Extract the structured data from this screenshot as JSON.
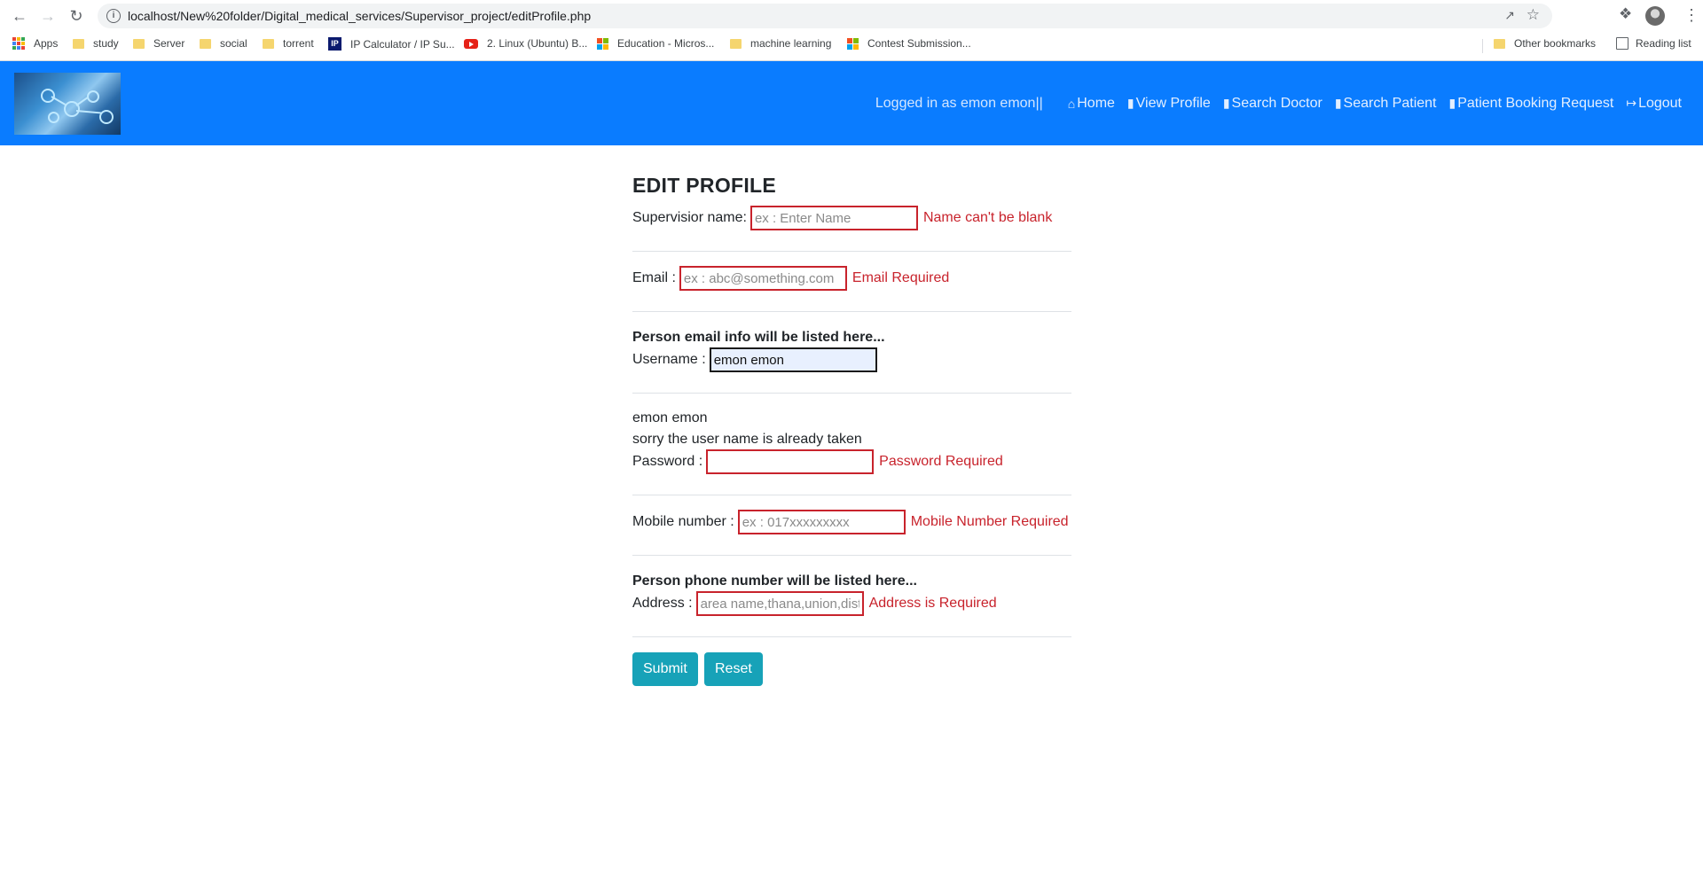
{
  "browser": {
    "url": "localhost/New%20folder/Digital_medical_services/Supervisor_project/editProfile.php",
    "bookmarks": [
      {
        "label": "Apps",
        "icon": "apps-grid-icon"
      },
      {
        "label": "study",
        "icon": "folder-icon"
      },
      {
        "label": "Server",
        "icon": "folder-icon"
      },
      {
        "label": "social",
        "icon": "folder-icon"
      },
      {
        "label": "torrent",
        "icon": "folder-icon"
      },
      {
        "label": "IP Calculator / IP Su...",
        "icon": "ip-icon"
      },
      {
        "label": "2. Linux (Ubuntu) B...",
        "icon": "youtube-icon"
      },
      {
        "label": "Education - Micros...",
        "icon": "microsoft-icon"
      },
      {
        "label": "machine learning",
        "icon": "folder-icon"
      },
      {
        "label": "Contest Submission...",
        "icon": "microsoft-icon"
      }
    ],
    "other_bookmarks": "Other bookmarks",
    "reading_list": "Reading list"
  },
  "site": {
    "logged_in": "Logged in as emon emon||",
    "nav": [
      {
        "label": "Home",
        "icon": "home-icon"
      },
      {
        "label": "View Profile",
        "icon": "id-card-icon"
      },
      {
        "label": "Search Doctor",
        "icon": "id-card-icon"
      },
      {
        "label": "Search Patient",
        "icon": "id-card-icon"
      },
      {
        "label": "Patient Booking Request",
        "icon": "id-card-icon"
      },
      {
        "label": "Logout",
        "icon": "logout-icon"
      }
    ]
  },
  "form": {
    "title": "EDIT PROFILE",
    "name_label": "Supervisior name:",
    "name_placeholder": "ex : Enter Name",
    "name_error": "Name can't be blank",
    "email_label": "Email :",
    "email_placeholder": "ex : abc@something.com",
    "email_error": "Email Required",
    "email_info": "Person email info will be listed here...",
    "username_label": "Username :",
    "username_value": "emon emon",
    "username_echo": "emon emon",
    "username_taken": "sorry the user name is already taken",
    "password_label": "Password :",
    "password_error": "Password Required",
    "mobile_label": "Mobile number :",
    "mobile_placeholder": "ex : 017xxxxxxxxx",
    "mobile_error": "Mobile Number Required",
    "phone_info": "Person phone number will be listed here...",
    "address_label": "Address :",
    "address_placeholder": "area name,thana,union,district",
    "address_error": "Address is Required",
    "submit": "Submit",
    "reset": "Reset"
  },
  "colors": {
    "navbar": "#0a7cff",
    "error": "#c8232c",
    "button": "#17a2b8"
  }
}
